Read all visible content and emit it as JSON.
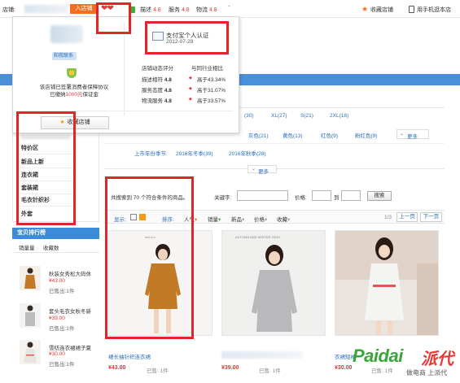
{
  "topbar": {
    "shop_label": "店铺:",
    "enter_shop": "入店铺",
    "desc_label": "描述",
    "desc_score": "4.8",
    "service_label": "服务",
    "service_score": "4.8",
    "logistics_label": "物流",
    "logistics_score": "4.8",
    "collect_shop": "收藏店铺",
    "mobile_shop": "用手机逛本店"
  },
  "popup": {
    "contact_tag": "和我联系",
    "guarantee_line1": "该店铺已签署消费者保障协议",
    "guarantee_line2_pre": "已缴纳",
    "guarantee_amount": "1000元",
    "guarantee_line2_post": "保证金",
    "collect_button": "收藏店铺",
    "cert_title": "支付宝个人认证",
    "cert_date": "2012-07-29",
    "rating_head_left": "店铺动态评分",
    "rating_head_right": "与同行业相比",
    "ratings": [
      {
        "label": "描述相符",
        "score": "4.8",
        "compare": "高于43.34%"
      },
      {
        "label": "服务态度",
        "score": "4.8",
        "compare": "高于31.07%"
      },
      {
        "label": "物流服务",
        "score": "4.8",
        "compare": "高于33.57%"
      }
    ]
  },
  "filters": {
    "sizes": [
      "(30)",
      "XL(27)",
      "S(21)",
      "2XL(18)"
    ],
    "colors": [
      "灰色(21)",
      "黄色(13)",
      "红色(9)",
      "粉红色(9)"
    ],
    "more": "更多",
    "season_label": "上市年份季节:",
    "seasons": [
      "2016年冬季(39)",
      "2016年秋季(28)"
    ],
    "more_center": "更多"
  },
  "categories": [
    "特价区",
    "新品上新",
    "连衣裙",
    "套装裙",
    "毛衣针织衫",
    "外套"
  ],
  "search": {
    "result_text": "共搜索到 70 个符合条件的商品。",
    "keyword_label": "关键字:",
    "price_label": "价格:",
    "price_to": "到",
    "search_button": "搜索"
  },
  "sortbar": {
    "display_label": "显示:",
    "sort_label": "排序:",
    "popularity": "人气",
    "sales": "销量",
    "newest": "新品",
    "price": "价格",
    "favorites": "收藏",
    "page_info": "1/3",
    "prev_page": "上一页",
    "next_page": "下一页"
  },
  "ranking": {
    "title": "宝贝排行榜",
    "tab_sales": "销量量",
    "tab_collect": "收藏数",
    "items": [
      {
        "title": "秋装女秀松大码休",
        "price": "¥43.00",
        "sold": "已售出:1件"
      },
      {
        "title": "套头毛衣女秋冬新",
        "price": "¥39.00",
        "sold": "已售出:1件"
      },
      {
        "title": "雪纺连衣裙裙子夏",
        "price": "¥30.00",
        "sold": "已售出:1件"
      }
    ]
  },
  "products": [
    {
      "img_caption": "",
      "title": "裙长袖针织连衣裙",
      "price": "¥43.00",
      "sold": "已售: 1件"
    },
    {
      "img_caption": "AUTUMN AND WINTER GRAY",
      "title": "",
      "price": "¥39.00",
      "sold": "已售: 1件"
    },
    {
      "img_caption": "",
      "title": "衣裙短裙",
      "price": "¥30.00",
      "sold": "已售: 1件"
    }
  ],
  "watermark": {
    "brand_en": "Paidai",
    "brand_cn": "派代",
    "slogan": "做电商 上派代"
  }
}
